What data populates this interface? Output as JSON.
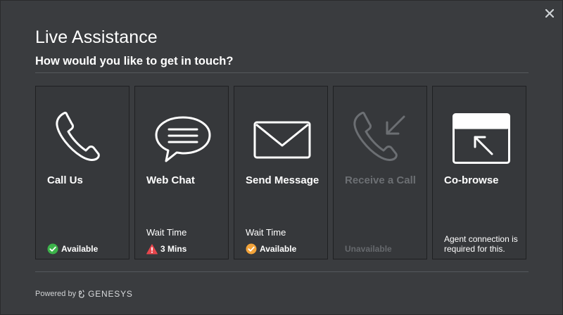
{
  "dialog": {
    "title": "Live Assistance",
    "subtitle": "How would you like to get in touch?"
  },
  "cards": [
    {
      "label": "Call Us",
      "wait_label": "",
      "status": "Available",
      "status_icon": "check-circle-icon",
      "status_color": "#3cb34a",
      "enabled": true
    },
    {
      "label": "Web Chat",
      "wait_label": "Wait Time",
      "status": "3 Mins",
      "status_icon": "warning-triangle-icon",
      "status_color": "#e8464d",
      "enabled": true
    },
    {
      "label": "Send Message",
      "wait_label": "Wait Time",
      "status": "Available",
      "status_icon": "check-circle-icon",
      "status_color": "#f2a33a",
      "enabled": true
    },
    {
      "label": "Receive a Call",
      "wait_label": "",
      "status": "Unavailable",
      "status_icon": "",
      "enabled": false
    },
    {
      "label": "Co-browse",
      "note": "Agent connection is required for this.",
      "enabled": true
    }
  ],
  "footer": {
    "powered_by": "Powered by",
    "brand": "GENESYS"
  },
  "colors": {
    "background": "#3a3c3f",
    "card_background": "#36383b",
    "divider": "#55585c",
    "available_green": "#3cb34a",
    "warning_red": "#e8464d",
    "available_orange": "#f2a33a"
  }
}
